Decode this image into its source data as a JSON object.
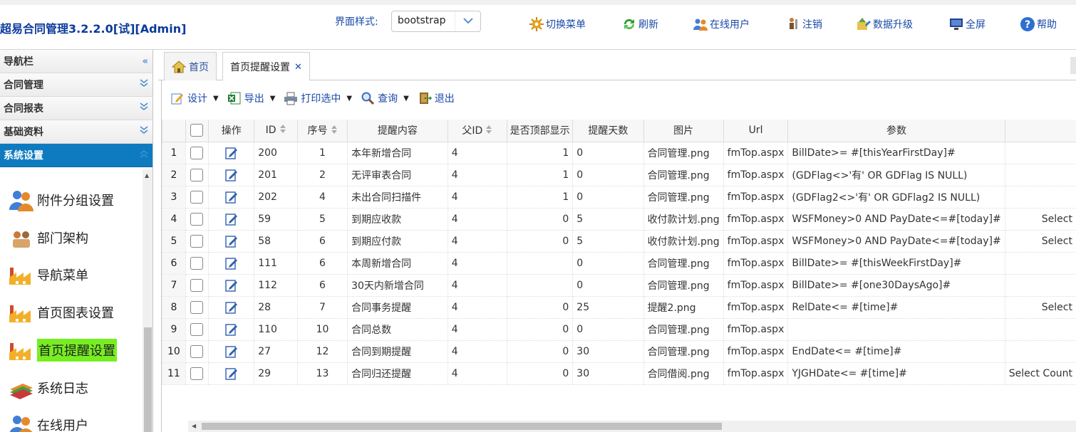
{
  "header": {
    "title": "超易合同管理3.2.2.0[试][Admin]",
    "style_label": "界面样式:",
    "style_value": "bootstrap",
    "buttons": [
      {
        "label": "切换菜单",
        "icon": "switch-menu-icon"
      },
      {
        "label": "刷新",
        "icon": "refresh-icon"
      },
      {
        "label": "在线用户",
        "icon": "online-users-icon"
      },
      {
        "label": "注销",
        "icon": "logout-icon"
      },
      {
        "label": "数据升级",
        "icon": "data-upgrade-icon"
      },
      {
        "label": "全屏",
        "icon": "fullscreen-icon"
      },
      {
        "label": "帮助",
        "icon": "help-icon"
      }
    ]
  },
  "sidebar": {
    "title": "导航栏",
    "groups": [
      {
        "label": "合同管理"
      },
      {
        "label": "合同报表"
      },
      {
        "label": "基础资料"
      },
      {
        "label": "系统设置"
      }
    ],
    "items": [
      {
        "label": "附件分组设置",
        "icon": "users-group-icon"
      },
      {
        "label": "部门架构",
        "icon": "org-chart-icon"
      },
      {
        "label": "导航菜单",
        "icon": "factory-icon"
      },
      {
        "label": "首页图表设置",
        "icon": "factory-icon"
      },
      {
        "label": "首页提醒设置",
        "icon": "factory-icon"
      },
      {
        "label": "系统日志",
        "icon": "books-icon"
      },
      {
        "label": "在线用户",
        "icon": "users-group-icon"
      }
    ]
  },
  "tabs": [
    {
      "label": "首页",
      "icon": "home-icon"
    },
    {
      "label": "首页提醒设置"
    }
  ],
  "toolbar": {
    "design": "设计",
    "export": "导出",
    "print": "打印选中",
    "query": "查询",
    "exit": "退出"
  },
  "table": {
    "columns": [
      "操作",
      "ID",
      "序号",
      "提醒内容",
      "父ID",
      "是否顶部显示",
      "提醒天数",
      "图片",
      "Url",
      "参数"
    ],
    "rows": [
      {
        "n": "1",
        "id": "200",
        "seq": "1",
        "content": "本年新增合同",
        "pid": "4",
        "top": "1",
        "days": "0",
        "img": "合同管理.png",
        "url": "fmTop.aspx",
        "param": "BillDate>= #[thisYearFirstDay]#",
        "extra": ""
      },
      {
        "n": "2",
        "id": "201",
        "seq": "2",
        "content": "无评审表合同",
        "pid": "4",
        "top": "1",
        "days": "0",
        "img": "合同管理.png",
        "url": "fmTop.aspx",
        "param": "(GDFlag<>'有' OR GDFlag IS NULL)",
        "extra": ""
      },
      {
        "n": "3",
        "id": "202",
        "seq": "4",
        "content": "未出合同扫描件",
        "pid": "4",
        "top": "1",
        "days": "0",
        "img": "合同管理.png",
        "url": "fmTop.aspx",
        "param": "(GDFlag2<>'有' OR GDFlag2 IS NULL)",
        "extra": ""
      },
      {
        "n": "4",
        "id": "59",
        "seq": "5",
        "content": "到期应收款",
        "pid": "4",
        "top": "0",
        "days": "5",
        "img": "收付款计划.png",
        "url": "fmTop.aspx",
        "param": "WSFMoney>0 AND PayDate<=#[today]#",
        "extra": "Select"
      },
      {
        "n": "5",
        "id": "58",
        "seq": "6",
        "content": "到期应付款",
        "pid": "4",
        "top": "0",
        "days": "5",
        "img": "收付款计划.png",
        "url": "fmTop.aspx",
        "param": "WSFMoney>0 AND PayDate<=#[today]#",
        "extra": "Select"
      },
      {
        "n": "6",
        "id": "111",
        "seq": "6",
        "content": "本周新增合同",
        "pid": "4",
        "top": "",
        "days": "0",
        "img": "合同管理.png",
        "url": "fmTop.aspx",
        "param": "BillDate>= #[thisWeekFirstDay]#",
        "extra": ""
      },
      {
        "n": "7",
        "id": "112",
        "seq": "6",
        "content": "30天内新增合同",
        "pid": "4",
        "top": "",
        "days": "0",
        "img": "合同管理.png",
        "url": "fmTop.aspx",
        "param": "BillDate>= #[one30DaysAgo]#",
        "extra": ""
      },
      {
        "n": "8",
        "id": "28",
        "seq": "7",
        "content": "合同事务提醒",
        "pid": "4",
        "top": "0",
        "days": "25",
        "img": "提醒2.png",
        "url": "fmTop.aspx",
        "param": "RelDate<= #[time]#",
        "extra": "Select"
      },
      {
        "n": "9",
        "id": "110",
        "seq": "10",
        "content": "合同总数",
        "pid": "4",
        "top": "0",
        "days": "0",
        "img": "合同管理.png",
        "url": "fmTop.aspx",
        "param": "",
        "extra": ""
      },
      {
        "n": "10",
        "id": "27",
        "seq": "12",
        "content": "合同到期提醒",
        "pid": "4",
        "top": "0",
        "days": "30",
        "img": "合同管理.png",
        "url": "fmTop.aspx",
        "param": "EndDate<= #[time]#",
        "extra": ""
      },
      {
        "n": "11",
        "id": "29",
        "seq": "13",
        "content": "合同归还提醒",
        "pid": "4",
        "top": "0",
        "days": "30",
        "img": "合同借阅.png",
        "url": "fmTop.aspx",
        "param": "YJGHDate<= #[time]#",
        "extra": "Select Count"
      }
    ]
  }
}
